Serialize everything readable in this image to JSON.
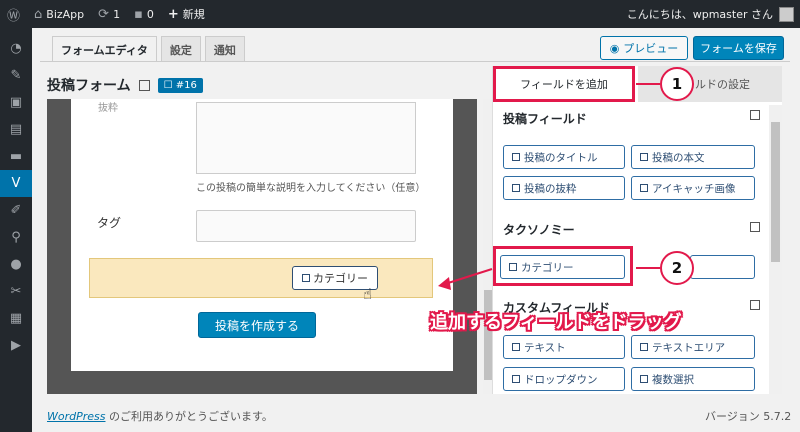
{
  "admin_bar": {
    "site_name": "BizApp",
    "updates_count": "1",
    "comments_count": "0",
    "new_label": "新規",
    "greeting": "こんにちは、wpmaster さん"
  },
  "tabs": [
    {
      "label": "フォームエディタ",
      "active": true
    },
    {
      "label": "設定",
      "active": false
    },
    {
      "label": "通知",
      "active": false
    }
  ],
  "toolbar": {
    "preview_label": "プレビュー",
    "save_label": "フォームを保存"
  },
  "form": {
    "title": "投稿フォーム",
    "id_badge": "#16",
    "excerpt_label": "抜粋",
    "excerpt_help": "この投稿の簡単な説明を入力してください（任意）",
    "tag_label": "タグ",
    "dragged_field": "カテゴリー",
    "submit_label": "投稿を作成する"
  },
  "panel": {
    "tab_add": "フィールドを追加",
    "tab_settings": "ールドの設定",
    "sections": [
      {
        "title": "投稿フィールド",
        "items": [
          "投稿のタイトル",
          "投稿の本文",
          "投稿の抜粋",
          "アイキャッチ画像"
        ]
      },
      {
        "title": "タクソノミー",
        "items": [
          "カテゴリー",
          ""
        ]
      },
      {
        "title": "カスタムフィールド",
        "items": [
          "テキスト",
          "テキストエリア",
          "ドロップダウン",
          "複数選択"
        ]
      }
    ]
  },
  "annotations": {
    "step1": "1",
    "step2": "2",
    "drag_instruction": "追加するフィールドをドラッグ",
    "accent_color": "#e2194b"
  },
  "footer": {
    "wp_link": "WordPress",
    "thanks": " のご利用ありがとうございます。",
    "version": "バージョン 5.7.2"
  }
}
